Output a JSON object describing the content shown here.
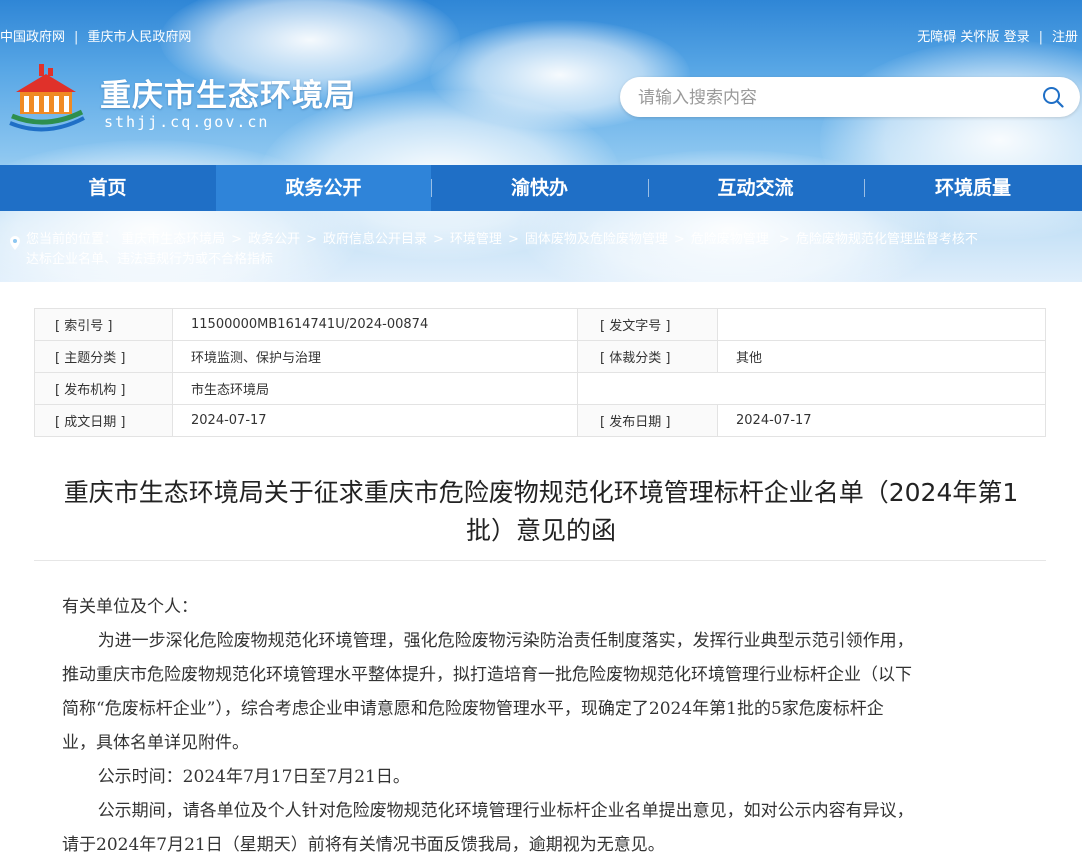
{
  "topbar": {
    "links_left": [
      "中国政府网",
      "|",
      "重庆市人民政府网"
    ],
    "links_right": [
      "无障碍",
      "关怀版",
      "登录",
      "|",
      "注册"
    ]
  },
  "brand": {
    "title": "重庆市生态环境局",
    "domain": "sthjj.cq.gov.cn"
  },
  "search": {
    "placeholder": "请输入搜索内容"
  },
  "nav": {
    "items": [
      {
        "label": "首页"
      },
      {
        "label": "政务公开",
        "active": true
      },
      {
        "label": "渝快办"
      },
      {
        "label": "互动交流"
      },
      {
        "label": "环境质量"
      }
    ]
  },
  "breadcrumb": {
    "prefix": "您当前的位置：",
    "items": [
      "重庆市生态环境局",
      "政务公开",
      "政府信息公开目录",
      "环境管理",
      "固体废物及危险废物管理",
      "危险废物管理",
      "危险废物规范化管理监督考核不达标企业名单、违法违规行为或不合格指标"
    ],
    "line2": "达标企业名单、违法违规行为或不合格指标"
  },
  "meta": {
    "index_label": "[ 索引号 ]",
    "index_value": "11500000MB1614741U/2024-00874",
    "docno_label": "[ 发文字号 ]",
    "docno_value": "",
    "topic_label": "[ 主题分类 ]",
    "topic_value": "环境监测、保护与治理",
    "genre_label": "[ 体裁分类 ]",
    "genre_value": "其他",
    "org_label": "[ 发布机构 ]",
    "org_value": "市生态环境局",
    "created_label": "[ 成文日期 ]",
    "created_value": "2024-07-17",
    "published_label": "[ 发布日期 ]",
    "published_value": "2024-07-17"
  },
  "article": {
    "title_line1": "重庆市生态环境局关于征求重庆市危险废物规范化环境管理标杆企业名单（2024年第1",
    "title_line2": "批）意见的函",
    "salutation": "有关单位及个人：",
    "p1_l1": "为进一步深化危险废物规范化环境管理，强化危险废物污染防治责任制度落实，发挥行业典型示范引领作用，",
    "p1_l2": "推动重庆市危险废物规范化环境管理水平整体提升，拟打造培育一批危险废物规范化环境管理行业标杆企业（以下",
    "p1_l3": "简称“危废标杆企业”），综合考虑企业申请意愿和危险废物管理水平，现确定了2024年第1批的5家危废标杆企",
    "p1_l4": "业，具体名单详见附件。",
    "p2": "公示时间：2024年7月17日至7月21日。",
    "p3_l1": "公示期间，请各单位及个人针对危险废物规范化环境管理行业标杆企业名单提出意见，如对公示内容有异议，",
    "p3_l2": "请于2024年7月21日（星期天）前将有关情况书面反馈我局，逾期视为无意见。"
  },
  "icons": {
    "logo": "government-emblem-icon",
    "search": "search-icon",
    "location": "location-pin-icon"
  },
  "colors": {
    "nav": "#1f6fc6",
    "nav_active": "#2f84d9",
    "sky": "#5aa8e6"
  }
}
